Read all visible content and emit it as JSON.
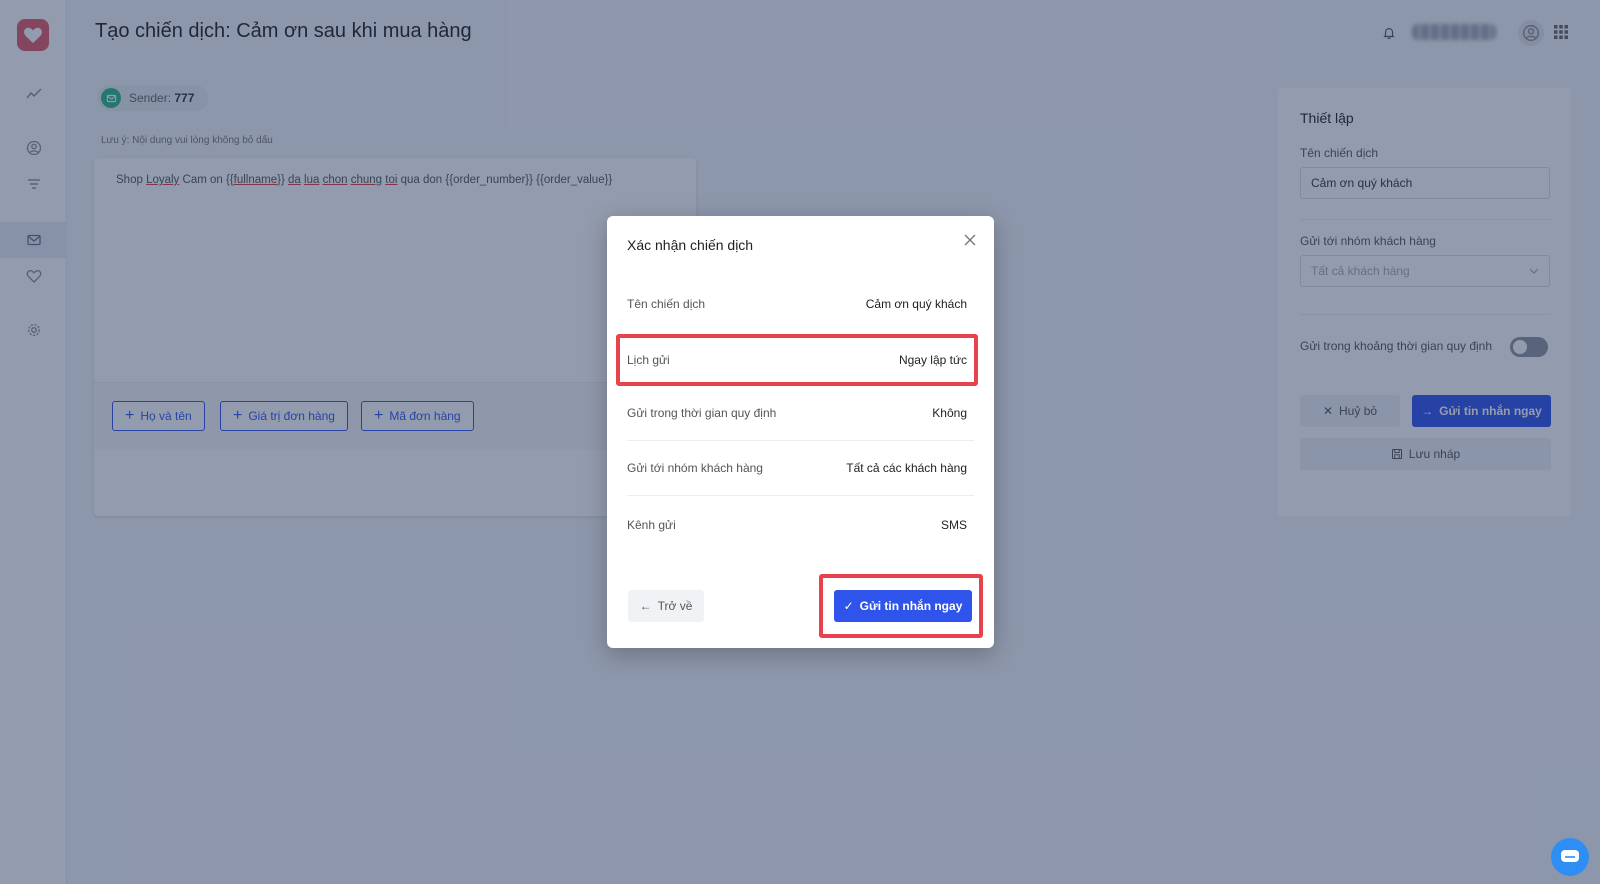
{
  "header": {
    "title": "Tạo chiến dịch: Cảm ơn sau khi mua hàng"
  },
  "sender": {
    "label": "Sender:",
    "value": "777"
  },
  "editor": {
    "note": "Lưu ý: Nội dung vui lòng không bỏ dấu",
    "message_parts": {
      "p1": "Shop ",
      "p2": "Loyaly",
      "p3": " Cam on {{",
      "p4": "fullname",
      "p5": "}} ",
      "p6": "da",
      "p7": " ",
      "p8": "lua",
      "p9": " ",
      "p10": "chon",
      "p11": " ",
      "p12": "chung",
      "p13": " ",
      "p14": "toi",
      "p15": " qua don {{order_number}} {{order_value}}"
    },
    "tags": [
      "Họ và tên",
      "Giá trị đơn hàng",
      "Mã đơn hàng"
    ]
  },
  "settings": {
    "title": "Thiết lập",
    "campaign_name_label": "Tên chiến dịch",
    "campaign_name_value": "Cảm ơn quý khách",
    "group_label": "Gửi tới nhóm khách hàng",
    "group_placeholder": "Tất cả khách hàng",
    "timeframe_label": "Gửi trong khoảng thời gian quy định",
    "cancel_label": "Huỷ bỏ",
    "send_label": "Gửi tin nhắn ngay",
    "draft_label": "Lưu nháp"
  },
  "modal": {
    "title": "Xác nhận chiến dịch",
    "rows": [
      {
        "key": "Tên chiến dịch",
        "value": "Cảm ơn quý khách"
      },
      {
        "key": "Lịch gửi",
        "value": "Ngay lập tức"
      },
      {
        "key": "Gửi trong thời gian quy định",
        "value": "Không"
      },
      {
        "key": "Gửi tới nhóm khách hàng",
        "value": "Tất cả các khách hàng"
      },
      {
        "key": "Kênh gửi",
        "value": "SMS"
      }
    ],
    "back_label": "Trở về",
    "send_label": "Gửi tin nhắn ngay"
  },
  "colors": {
    "primary": "#2f54eb",
    "highlight": "#e8424e",
    "brand": "#e05a66"
  },
  "icons": {
    "logo": "heart-icon",
    "nav": [
      "chart-line-icon",
      "user-circle-icon",
      "filter-icon",
      "mail-icon",
      "heart-icon",
      "gear-icon"
    ],
    "header": [
      "bell-icon",
      "avatar-icon",
      "apps-grid-icon"
    ],
    "chat": "chat-icon"
  }
}
